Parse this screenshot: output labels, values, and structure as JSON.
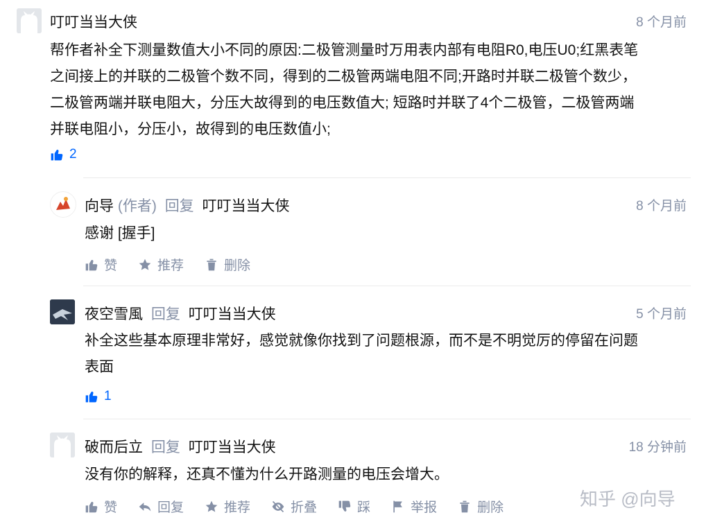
{
  "comments": [
    {
      "author": "叮叮当当大侠",
      "time": "8 个月前",
      "lines": [
        "帮作者补全下测量数值大小不同的原因:二极管测量时万用表内部有电阻R0,电压U0;红黑表笔",
        "之间接上的并联的二极管个数不同，得到的二极管两端电阻不同;开路时并联二极管个数少，",
        "二极管两端并联电阻大，分压大故得到的电压数值大; 短路时并联了4个二极管，二极管两端",
        "并联电阻小，分压小，故得到的电压数值小;"
      ],
      "likes": "2"
    }
  ],
  "replies": [
    {
      "author": "向导",
      "role": "(作者)",
      "reply_word": "回复",
      "target": "叮叮当当大侠",
      "time": "8 个月前",
      "lines": [
        "感谢 [握手]"
      ],
      "actions": [
        "赞",
        "推荐",
        "删除"
      ]
    },
    {
      "author": "夜空雪風",
      "reply_word": "回复",
      "target": "叮叮当当大侠",
      "time": "5 个月前",
      "lines": [
        "补全这些基本原理非常好，感觉就像你找到了问题根源，而不是不明觉厉的停留在问题",
        "表面"
      ],
      "likes": "1"
    },
    {
      "author": "破而后立",
      "reply_word": "回复",
      "target": "叮叮当当大侠",
      "time": "18 分钟前",
      "lines": [
        "没有你的解释，还真不懂为什么开路测量的电压会增大。"
      ],
      "actions": [
        "赞",
        "回复",
        "推荐",
        "折叠",
        "踩",
        "举报",
        "删除"
      ]
    }
  ],
  "watermark": "知乎 @向导",
  "colors": {
    "accent": "#0066ff",
    "meta": "#8590a6",
    "text": "#121212"
  }
}
